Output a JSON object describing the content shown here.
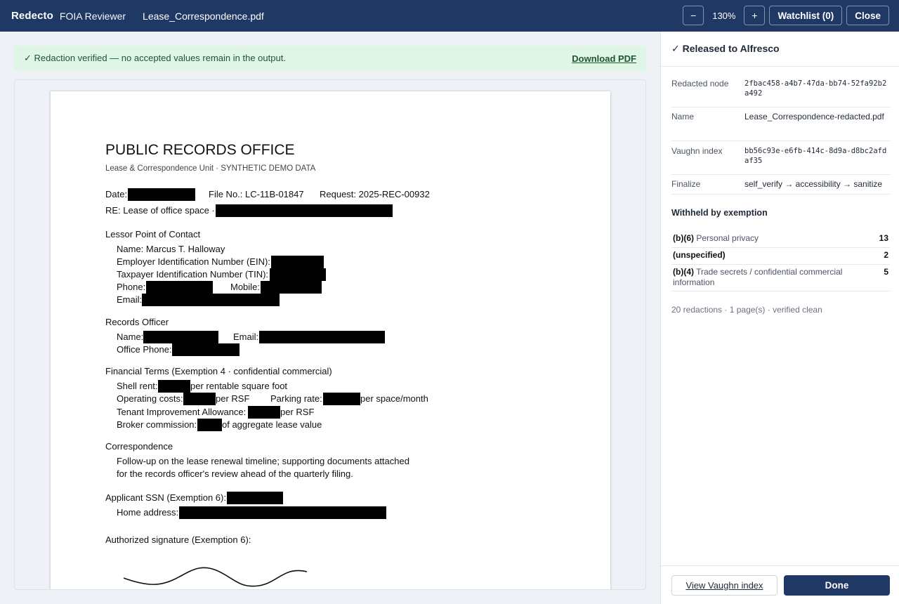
{
  "app": {
    "brand": "Redecto",
    "product": "FOIA Reviewer",
    "filename": "Lease_Correspondence.pdf"
  },
  "toolbar": {
    "zoom_out": "−",
    "zoom_level": "130%",
    "zoom_in": "+",
    "watchlist": "Watchlist (0)",
    "close": "Close"
  },
  "banner": {
    "message": "✓ Redaction verified — no accepted values remain in the output.",
    "download": "Download PDF"
  },
  "document": {
    "title": "PUBLIC RECORDS OFFICE",
    "subtitle": "Lease & Correspondence Unit  ·  SYNTHETIC DEMO DATA",
    "date_label": "Date:",
    "file_no": "File No.: LC-11B-01847",
    "request": "Request: 2025-REC-00932",
    "re": "RE: Lease of office space ·",
    "lessor_heading": "Lessor Point of Contact",
    "lessor_name": "Name: Marcus T. Halloway",
    "ein": "Employer Identification Number (EIN):",
    "tin": "Taxpayer Identification Number (TIN):",
    "phone": "Phone:",
    "mobile": "Mobile:",
    "email": "Email:",
    "officer_heading": "Records Officer",
    "officer_name": "Name:",
    "officer_email": "Email:",
    "office_phone": "Office Phone:",
    "financial_heading": "Financial Terms (Exemption 4 · confidential commercial)",
    "shell_rent": "Shell rent:",
    "shell_rent_suffix": "per rentable square foot",
    "operating_costs": "Operating costs:",
    "per_rsf": "per RSF",
    "parking_rate": "Parking rate:",
    "parking_suffix": "per space/month",
    "tia": "Tenant Improvement Allowance:",
    "tia_suffix": "per RSF",
    "broker": "Broker commission:",
    "broker_suffix": "of aggregate lease value",
    "corr_heading": "Correspondence",
    "corr_line1": "Follow-up on the lease renewal timeline; supporting documents attached",
    "corr_line2": "for the records officer's review ahead of the quarterly filing.",
    "ssn": "Applicant SSN (Exemption 6):",
    "home_address": "Home address:",
    "signature": "Authorized signature (Exemption 6):"
  },
  "panel": {
    "header": "✓ Released to Alfresco",
    "fields": [
      {
        "key": "Redacted node",
        "value": "2fbac458-a4b7-47da-bb74-52fa92b2a492"
      },
      {
        "key": "Name",
        "value": "Lease_Correspondence-redacted.pdf"
      },
      {
        "key": "Vaughn index",
        "value": "bb56c93e-e6fb-414c-8d9a-d8bc2afdaf35"
      },
      {
        "key": "Finalize",
        "value": "self_verify → accessibility → sanitize"
      }
    ],
    "withheld_title": "Withheld by exemption",
    "exemptions": [
      {
        "code": "(b)(6)",
        "desc": "Personal privacy",
        "count": "13"
      },
      {
        "code": "(unspecified)",
        "desc": "",
        "count": "2"
      },
      {
        "code": "(b)(4)",
        "desc": "Trade secrets / confidential commercial information",
        "count": "5"
      }
    ],
    "summary": "20 redactions · 1 page(s) · verified clean",
    "vaughn_button": "View Vaughn index",
    "done_button": "Done"
  }
}
